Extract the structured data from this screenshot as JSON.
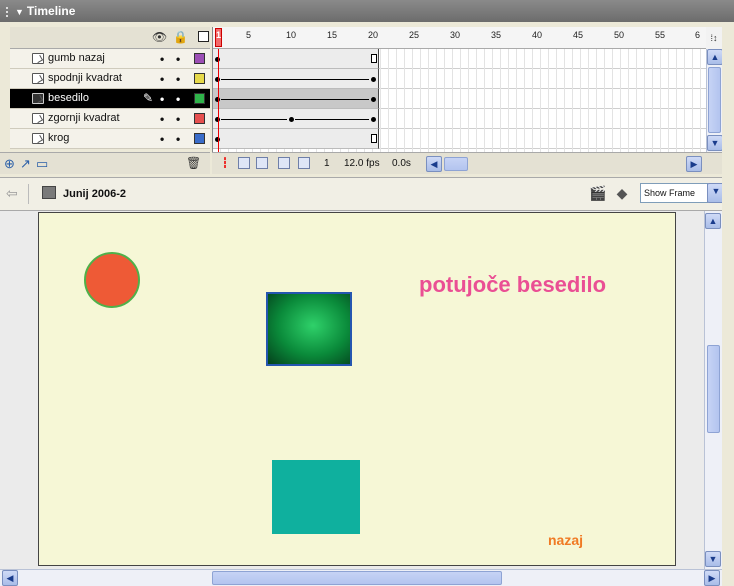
{
  "panel": {
    "title": "Timeline",
    "collapse_icon": "triangle-down-icon"
  },
  "layer_header": {
    "icons": [
      "eye-icon",
      "lock-icon",
      "outline-icon"
    ]
  },
  "layers": [
    {
      "name": "gumb nazaj",
      "color": "#9c4fb5",
      "selected": false
    },
    {
      "name": "spodnji kvadrat",
      "color": "#e6d94a",
      "selected": false
    },
    {
      "name": "besedilo",
      "color": "#2fb34a",
      "selected": true
    },
    {
      "name": "zgornji kvadrat",
      "color": "#e6504f",
      "selected": false
    },
    {
      "name": "krog",
      "color": "#3a6cc9",
      "selected": false
    }
  ],
  "layer_footer": {
    "icons": [
      "insert-layer-icon",
      "add-motion-guide-icon",
      "insert-folder-icon",
      "delete-layer-icon"
    ]
  },
  "ruler": {
    "numbers": [
      "1",
      "5",
      "10",
      "15",
      "20",
      "25",
      "30",
      "35",
      "40",
      "45",
      "50",
      "55",
      "6"
    ],
    "current_frame_marker": "1"
  },
  "frame_status": {
    "current_frame": "1",
    "frame_rate": "12.0 fps",
    "elapsed_time": "0.0s",
    "icons": [
      "center-frame-icon",
      "onion-skin-icon",
      "onion-skin-outlines-icon",
      "edit-multiple-frames-icon",
      "modify-onion-markers-icon"
    ]
  },
  "edit_bar": {
    "back_icon": "back-arrow-icon",
    "scene_icon": "scene-icon",
    "scene_name": "Junij 2006-2",
    "edit_scene_icon": "edit-scene-icon",
    "edit_symbols_icon": "edit-symbols-icon",
    "zoom_value": "Show Frame"
  },
  "stage": {
    "moving_text": "potujoče besedilo",
    "back_button_text": "nazaj",
    "colors": {
      "background": "#f6f7d6",
      "circle": "#ee5a36",
      "green_square": "#1aa950",
      "teal_square": "#0fb09e",
      "moving_text": "#ea4f94",
      "back_text": "#f07a24"
    }
  }
}
